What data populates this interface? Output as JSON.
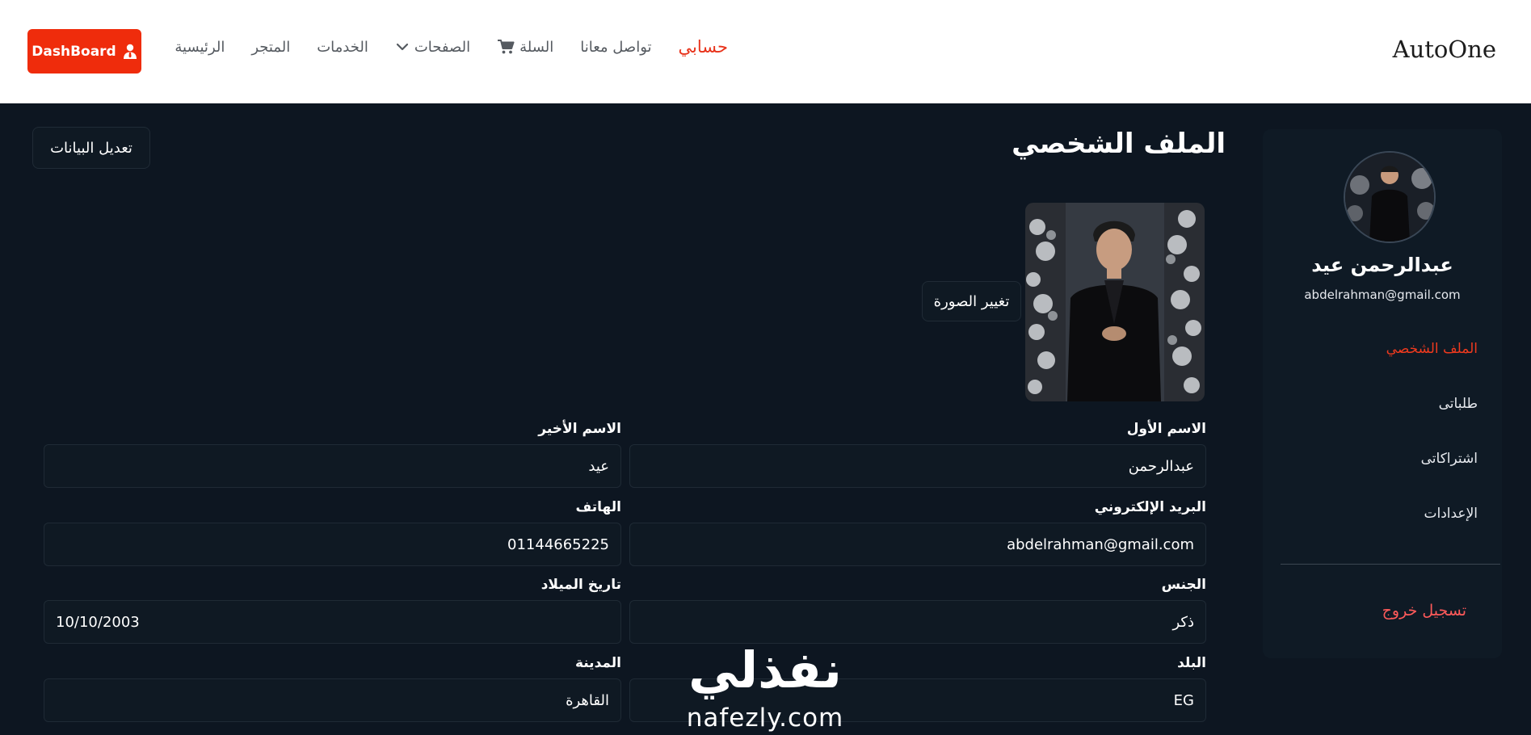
{
  "navbar": {
    "brand": "AutoOne",
    "links": [
      {
        "label": "الرئيسية"
      },
      {
        "label": "المتجر"
      },
      {
        "label": "الخدمات"
      },
      {
        "label": "الصفحات",
        "icon": "chevron-down-icon"
      },
      {
        "label": "السلة",
        "icon": "cart-icon"
      },
      {
        "label": "تواصل معانا"
      },
      {
        "label": "حسابي",
        "active": true
      }
    ],
    "dashboard_button": {
      "label": "DashBoard",
      "icon": "user-tie-icon"
    }
  },
  "sidebar": {
    "user_name": "عبدالرحمن عيد",
    "user_email": "abdelrahman@gmail.com",
    "items": [
      {
        "label": "الملف الشخصي",
        "active": true
      },
      {
        "label": "طلباتى"
      },
      {
        "label": "اشتراكاتى"
      },
      {
        "label": "الإعدادات"
      }
    ],
    "logout_label": "تسجيل خروج"
  },
  "main": {
    "title": "الملف الشخصي",
    "edit_button": "تعديل البيانات",
    "change_photo_button": "تغيير الصورة",
    "fields": {
      "first_name": {
        "label": "الاسم الأول",
        "value": "عبدالرحمن"
      },
      "last_name": {
        "label": "الاسم الأخير",
        "value": "عيد"
      },
      "email": {
        "label": "البريد الإلكتروني",
        "value": "abdelrahman@gmail.com"
      },
      "phone": {
        "label": "الهاتف",
        "value": "01144665225"
      },
      "gender": {
        "label": "الجنس",
        "value": "ذكر"
      },
      "birth_date": {
        "label": "تاريخ الميلاد",
        "value": "10/10/2003"
      },
      "country": {
        "label": "البلد",
        "value": "EG"
      },
      "city": {
        "label": "المدينة",
        "value": "القاهرة"
      }
    }
  },
  "watermark": {
    "arabic": "نفذلي",
    "latin": "nafezly.com"
  },
  "colors": {
    "accent": "#ef2c0c",
    "background": "#0d1621",
    "logout": "#ff5a5a"
  }
}
